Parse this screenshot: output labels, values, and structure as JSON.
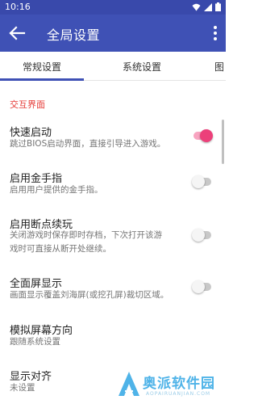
{
  "status_bar": {
    "time": "10:16"
  },
  "app_bar": {
    "title": "全局设置"
  },
  "tabs": [
    {
      "label": "常规设置",
      "active": true
    },
    {
      "label": "系统设置",
      "active": false
    },
    {
      "label": "图",
      "active": false
    }
  ],
  "section": {
    "title": "交互界面"
  },
  "settings": [
    {
      "title": "快速启动",
      "subtitle": "跳过BIOS启动界面，直接引导进入游戏。",
      "switch_on": true
    },
    {
      "title": "启用金手指",
      "subtitle": "启用用户提供的金手指。",
      "switch_on": false
    },
    {
      "title": "启用断点续玩",
      "subtitle_lines": [
        "关闭游戏时保存即时存档，下次打开该游",
        "戏时可直接从断开处继续。"
      ],
      "switch_on": false
    },
    {
      "title": "全面屏显示",
      "subtitle": "画面显示覆盖刘海屏(或挖孔屏)裁切区域。",
      "switch_on": false
    },
    {
      "title": "模拟屏幕方向",
      "subtitle": "跟随系统设置"
    },
    {
      "title": "显示对齐",
      "subtitle": "未设置"
    }
  ],
  "watermark": {
    "text": "奥派软件园",
    "sub": "AOPAIRUANJIAN.COM"
  },
  "colors": {
    "primary": "#3f51b5",
    "accent": "#ec407a",
    "section": "#e53935"
  }
}
